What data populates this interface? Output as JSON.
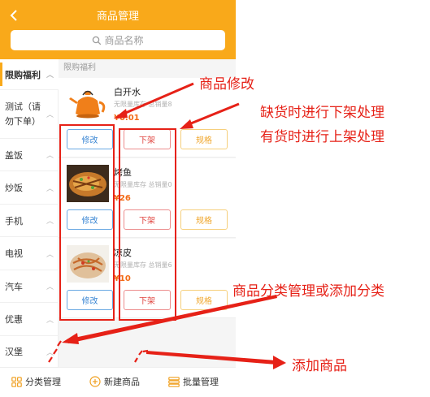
{
  "header": {
    "title": "商品管理",
    "back_icon": "chevron-left-icon"
  },
  "search": {
    "placeholder": "商品名称",
    "icon": "search-icon"
  },
  "sidebar": {
    "items": [
      {
        "label": "限购福利",
        "active": true
      },
      {
        "label": "测试（请勿下单）",
        "active": false
      },
      {
        "label": "盖饭",
        "active": false
      },
      {
        "label": "炒饭",
        "active": false
      },
      {
        "label": "手机",
        "active": false
      },
      {
        "label": "电视",
        "active": false
      },
      {
        "label": "汽车",
        "active": false
      },
      {
        "label": "优惠",
        "active": false
      },
      {
        "label": "汉堡",
        "active": false
      }
    ]
  },
  "section": {
    "title": "限购福利"
  },
  "products": [
    {
      "name": "白开水",
      "meta": "无限量库存 总销量8",
      "price": "¥0.01",
      "edit_label": "修改",
      "shelf_label": "下架",
      "spec_label": "规格"
    },
    {
      "name": "烤鱼",
      "meta": "无限量库存 总销量0",
      "price": "¥26",
      "edit_label": "修改",
      "shelf_label": "下架",
      "spec_label": "规格"
    },
    {
      "name": "凉皮",
      "meta": "无限量库存 总销量6",
      "price": "¥10",
      "edit_label": "修改",
      "shelf_label": "下架",
      "spec_label": "规格"
    }
  ],
  "bottom_bar": {
    "category_label": "分类管理",
    "new_label": "新建商品",
    "batch_label": "批量管理"
  },
  "annotations": {
    "edit_note": "商品修改",
    "shelf_note_1": "缺货时进行下架处理",
    "shelf_note_2": "有货时进行上架处理",
    "category_note": "商品分类管理或添加分类",
    "add_note": "添加商品"
  },
  "colors": {
    "accent": "#f9a91a",
    "annotation": "#e62117",
    "price": "#f36a16",
    "edit_button": "#3b87d4",
    "shelf_button": "#e0443f",
    "spec_button": "#f0a830"
  }
}
